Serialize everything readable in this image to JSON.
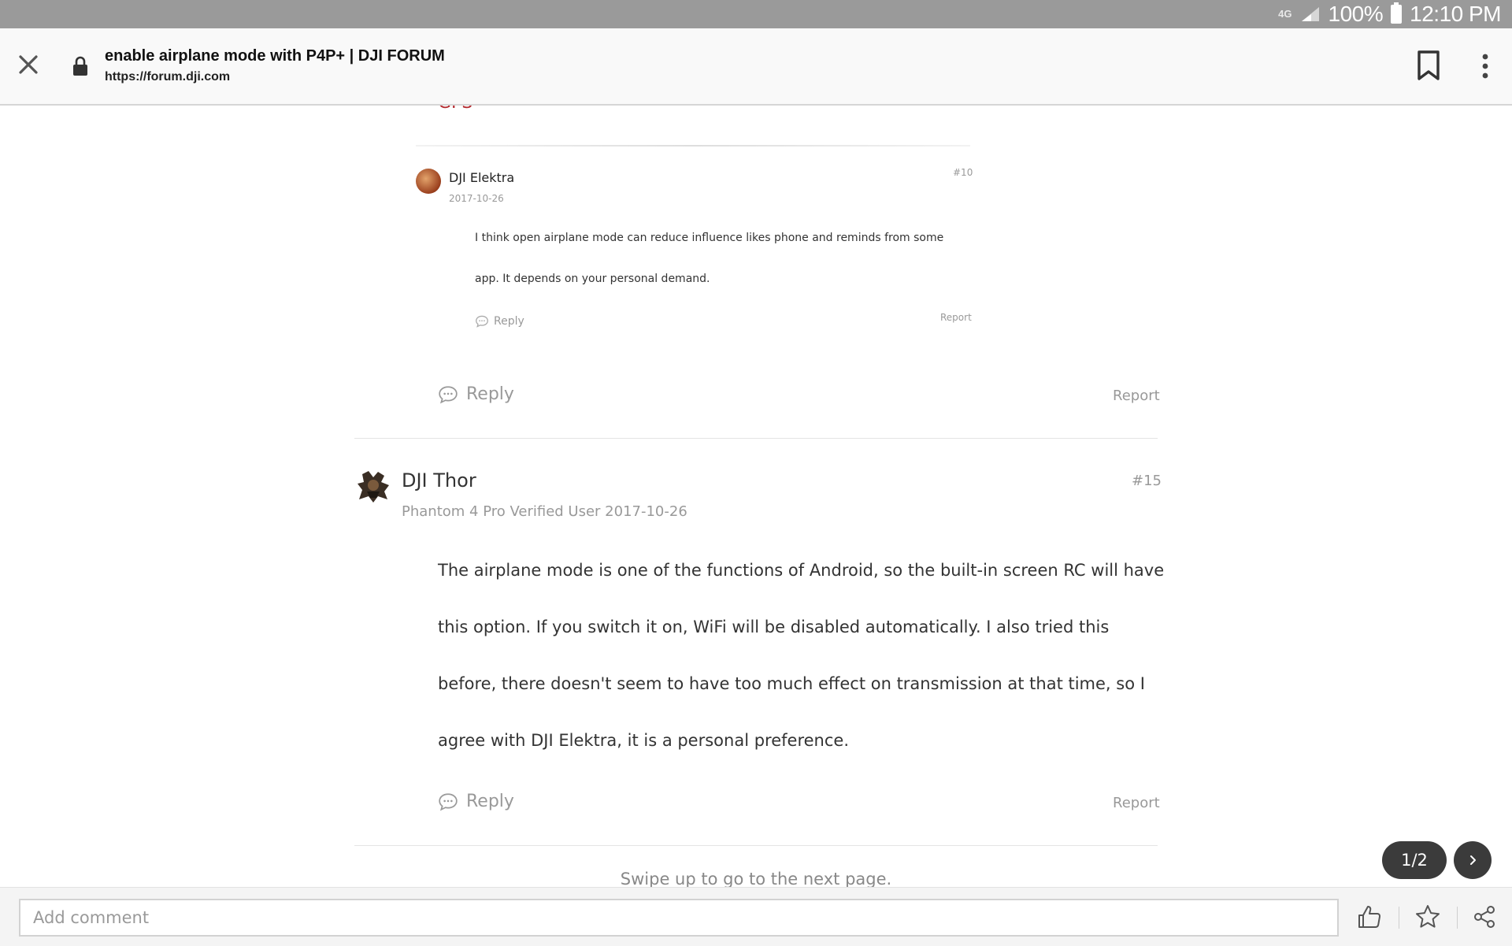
{
  "status_bar": {
    "network": "4G",
    "battery": "100%",
    "time": "12:10 PM"
  },
  "browser": {
    "title": "enable airplane mode with P4P+ | DJI FORUM",
    "url": "https://forum.dji.com"
  },
  "quoted_post": {
    "prev_text_fragment": "GPS",
    "author": "DJI Elektra",
    "date": "2017-10-26",
    "number": "#10",
    "lines": [
      "I think open airplane mode can reduce influence likes phone and reminds from some",
      "app. It depends on your personal demand."
    ],
    "reply_label": "Reply",
    "report_label": "Report"
  },
  "previous_post_actions": {
    "reply_label": "Reply",
    "report_label": "Report"
  },
  "post": {
    "author": "DJI Thor",
    "meta": "Phantom 4 Pro Verified User  2017-10-26",
    "number": "#15",
    "lines": [
      "The airplane mode is one of the functions of Android, so the built-in screen RC will have",
      "this option. If you switch it on, WiFi will be disabled automatically. I also tried this",
      "before, there doesn't seem to have too much effect on transmission at that time, so I",
      "agree with DJI Elektra, it is a personal preference."
    ],
    "reply_label": "Reply",
    "report_label": "Report"
  },
  "swipe_hint": "Swipe up to go to the next page.",
  "pager": {
    "label": "1/2"
  },
  "bottom_bar": {
    "comment_placeholder": "Add comment"
  },
  "icons": {
    "close": "close-icon",
    "lock": "lock-icon",
    "bookmark": "bookmark-icon",
    "more": "more-vert-icon",
    "reply": "speech-bubble-icon",
    "next": "chevron-right-icon",
    "like": "thumbs-up-icon",
    "favorite": "star-icon",
    "share": "share-icon"
  },
  "colors": {
    "status_bar": "#9a9a9a",
    "accent_red": "#b3282d",
    "pager_bg": "#3b3b3b"
  }
}
